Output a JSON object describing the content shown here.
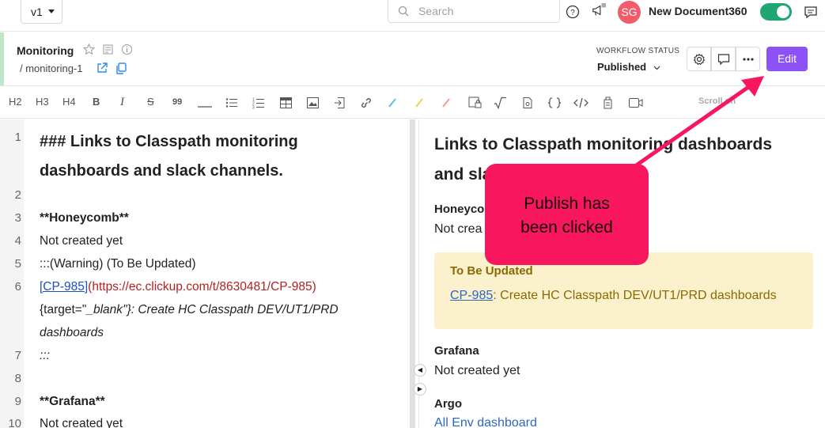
{
  "topbar": {
    "version": "v1",
    "search_placeholder": "Search",
    "avatar_initials": "SG",
    "project_name": "New Document360"
  },
  "article": {
    "title": "Monitoring",
    "slug": "/ monitoring-1",
    "workflow_label": "WORKFLOW STATUS",
    "workflow_value": "Published",
    "edit_label": "Edit"
  },
  "toolbar": {
    "h2": "H2",
    "h3": "H3",
    "h4": "H4",
    "bold": "B",
    "italic": "I",
    "strike": "S",
    "quote": "99",
    "scroll_label": "Scroll on"
  },
  "editor": {
    "lines": [
      {
        "num": "1",
        "text": "### Links to Classpath monitoring"
      },
      {
        "num": "",
        "text": "dashboards and slack channels."
      },
      {
        "num": "2",
        "text": ""
      },
      {
        "num": "3",
        "text": "**Honeycomb**"
      },
      {
        "num": "4",
        "text": "Not created yet"
      },
      {
        "num": "5",
        "text": ":::(Warning) (To Be Updated)"
      },
      {
        "num": "6",
        "link": "[CP-985]",
        "url": "(https://ec.clickup.com/t/8630481/CP-985)"
      },
      {
        "num": "",
        "text_a": "{target=\"",
        "text_b": "_blank",
        "text_c": "\"}: Create HC Classpath DEV/UT1/PRD"
      },
      {
        "num": "",
        "text": "dashboards"
      },
      {
        "num": "7",
        "text": ":::"
      },
      {
        "num": "8",
        "text": ""
      },
      {
        "num": "9",
        "text": "**Grafana**"
      },
      {
        "num": "10",
        "text": "Not created yet"
      }
    ]
  },
  "preview": {
    "heading_1": "Links to Classpath monitoring dashboards",
    "heading_2": "and sla",
    "honeycomb_label": "Honeyco",
    "honeycomb_text": "Not crea",
    "callout_title": "To Be Updated",
    "callout_link": "CP-985",
    "callout_text": ": Create HC Classpath DEV/UT1/PRD dashboards",
    "grafana_label": "Grafana",
    "grafana_text": "Not created yet",
    "argo_label": "Argo",
    "argo_link": "All Env dashboard"
  },
  "annotation": {
    "line1": "Publish has",
    "line2": "been clicked",
    "color": "#f8175f"
  },
  "colors": {
    "edit_button": "#8c52f7",
    "toggle_on": "#1fa672",
    "avatar": "#f15b6c",
    "callout_bg": "#fcf1cd"
  }
}
